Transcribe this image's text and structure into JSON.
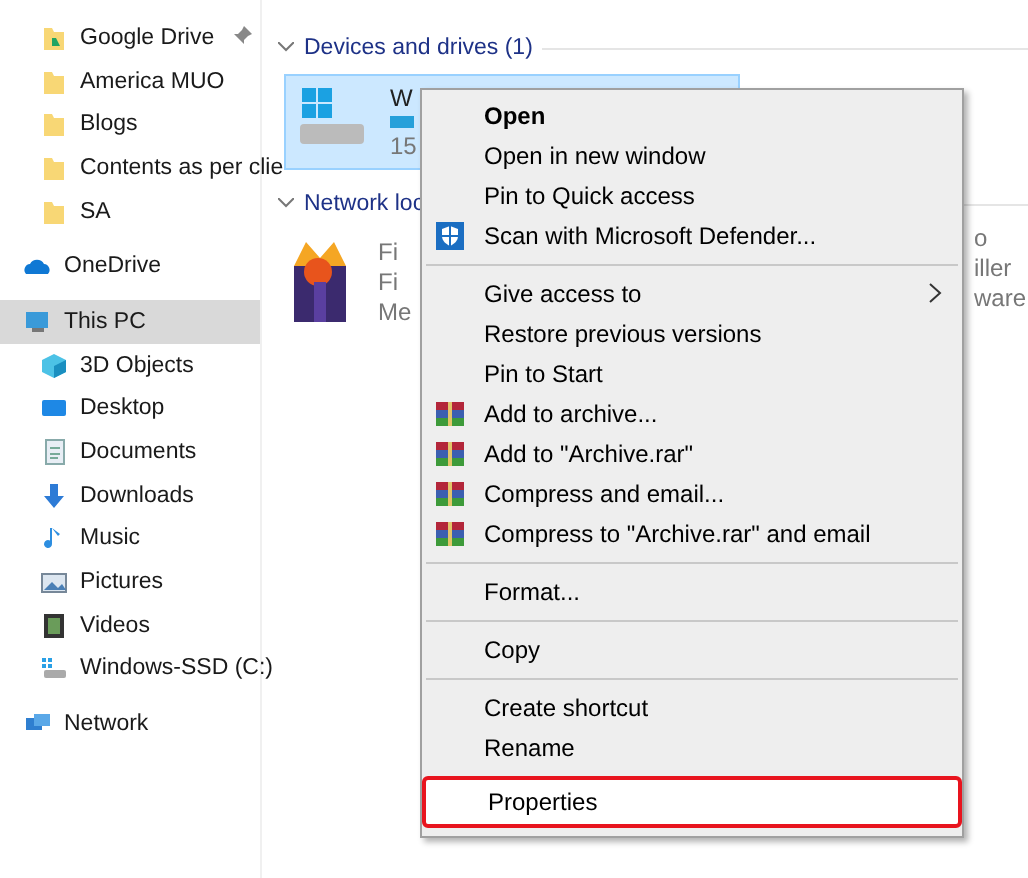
{
  "sidebar": {
    "quick_access": [
      {
        "label": "Google Drive",
        "kind": "gdrive",
        "pinned": true
      },
      {
        "label": "America MUO",
        "kind": "folder",
        "pinned": false
      },
      {
        "label": "Blogs",
        "kind": "folder",
        "pinned": false
      },
      {
        "label": "Contents as per clie",
        "kind": "folder",
        "pinned": false
      },
      {
        "label": "SA",
        "kind": "folder",
        "pinned": false
      }
    ],
    "onedrive": {
      "label": "OneDrive",
      "selected": false
    },
    "this_pc": {
      "label": "This PC",
      "selected": true,
      "children": [
        {
          "label": "3D Objects",
          "kind": "cube"
        },
        {
          "label": "Desktop",
          "kind": "desktop"
        },
        {
          "label": "Documents",
          "kind": "documents"
        },
        {
          "label": "Downloads",
          "kind": "downloads"
        },
        {
          "label": "Music",
          "kind": "music"
        },
        {
          "label": "Pictures",
          "kind": "pictures"
        },
        {
          "label": "Videos",
          "kind": "videos"
        },
        {
          "label": "Windows-SSD (C:)",
          "kind": "drive"
        }
      ]
    },
    "network": {
      "label": "Network",
      "selected": false
    }
  },
  "devices": {
    "header": "Devices and drives (1)",
    "drive": {
      "name": "W",
      "size": "15",
      "selected": true
    }
  },
  "network_locations": {
    "header": "Network loc",
    "item": {
      "lines": [
        "Fi",
        "Fi",
        "Me"
      ],
      "right_lines": [
        "o",
        "iller",
        "ware"
      ]
    }
  },
  "context_menu": [
    {
      "kind": "item",
      "label": "Open",
      "bold": true,
      "selected": false
    },
    {
      "kind": "item",
      "label": "Open in new window",
      "selected": false
    },
    {
      "kind": "item",
      "label": "Pin to Quick access",
      "selected": false
    },
    {
      "kind": "shielded",
      "label": "Scan with Microsoft Defender...",
      "selected": false
    },
    {
      "kind": "separator"
    },
    {
      "kind": "item",
      "label": "Give access to",
      "submenu": true,
      "selected": false
    },
    {
      "kind": "item",
      "label": "Restore previous versions",
      "selected": false
    },
    {
      "kind": "item",
      "label": "Pin to Start",
      "selected": false
    },
    {
      "kind": "archive",
      "label": "Add to archive...",
      "selected": false
    },
    {
      "kind": "archive",
      "label": "Add to \"Archive.rar\"",
      "selected": false
    },
    {
      "kind": "archive",
      "label": "Compress and email...",
      "selected": false
    },
    {
      "kind": "archive",
      "label": "Compress to \"Archive.rar\" and email",
      "selected": false
    },
    {
      "kind": "separator"
    },
    {
      "kind": "item",
      "label": "Format...",
      "selected": false
    },
    {
      "kind": "separator"
    },
    {
      "kind": "item",
      "label": "Copy",
      "selected": false
    },
    {
      "kind": "separator"
    },
    {
      "kind": "item",
      "label": "Create shortcut",
      "selected": false
    },
    {
      "kind": "item",
      "label": "Rename",
      "selected": false
    },
    {
      "kind": "item",
      "label": "Properties",
      "selected": true
    }
  ]
}
